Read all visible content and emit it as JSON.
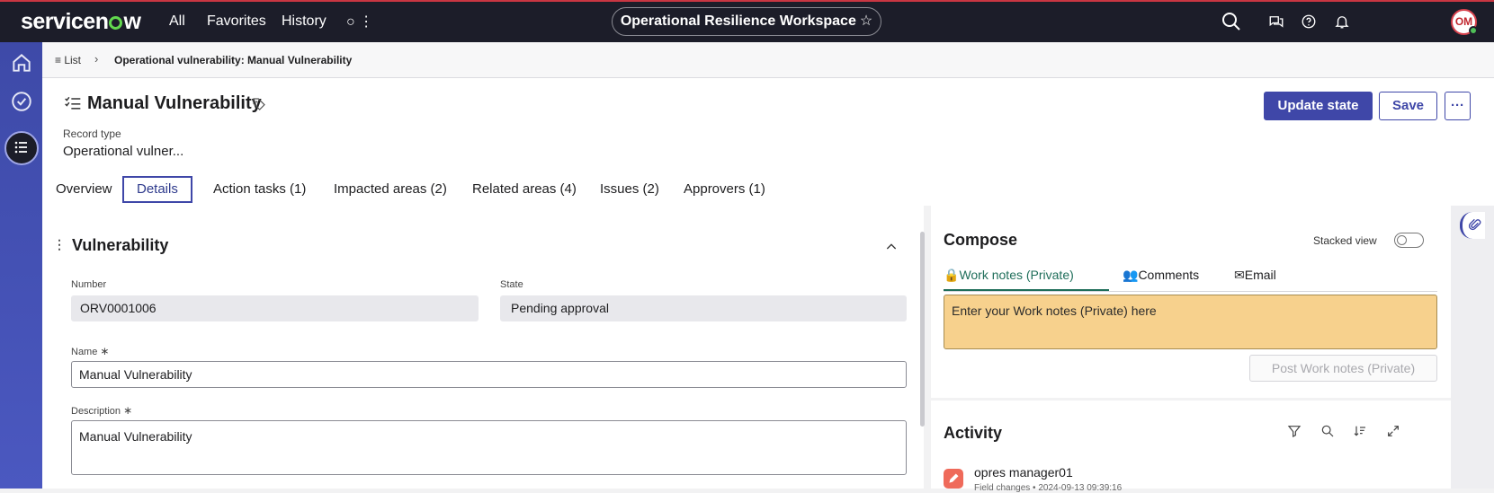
{
  "topbar": {
    "logo_text": "servicenow",
    "nav": [
      "All",
      "Favorites",
      "History"
    ],
    "workspace_title": "Operational Resilience Workspace",
    "avatar_initials": "OM"
  },
  "breadcrumb": {
    "list_label": "List",
    "current": "Operational vulnerability: Manual Vulnerability"
  },
  "record": {
    "title": "Manual Vulnerability",
    "record_type_label": "Record type",
    "record_type_value": "Operational vulner...",
    "update_state_label": "Update state",
    "save_label": "Save"
  },
  "tabs": [
    {
      "label": "Overview"
    },
    {
      "label": "Details"
    },
    {
      "label": "Action tasks (1)"
    },
    {
      "label": "Impacted areas (2)"
    },
    {
      "label": "Related areas (4)"
    },
    {
      "label": "Issues (2)"
    },
    {
      "label": "Approvers (1)"
    }
  ],
  "form": {
    "section_title": "Vulnerability",
    "number_label": "Number",
    "number_value": "ORV0001006",
    "state_label": "State",
    "state_value": "Pending approval",
    "name_label": "Name",
    "name_value": "Manual Vulnerability",
    "description_label": "Description",
    "description_value": "Manual Vulnerability",
    "required_mark": "∗"
  },
  "compose": {
    "title": "Compose",
    "stacked_view_label": "Stacked view",
    "tabs": [
      "Work notes (Private)",
      "Comments",
      "Email"
    ],
    "notes_placeholder": "Enter your Work notes (Private) here",
    "post_label": "Post Work notes (Private)"
  },
  "activity": {
    "title": "Activity",
    "user": "opres manager01",
    "subtitle": "Field changes • 2024-09-13 09:39:16"
  },
  "colors": {
    "topbar_bg": "#1c1d29",
    "accent": "#3f47a8",
    "rail": "#4451b4",
    "work_notes_bg": "#f7d18d",
    "work_notes_tab": "#1f6e5a"
  }
}
